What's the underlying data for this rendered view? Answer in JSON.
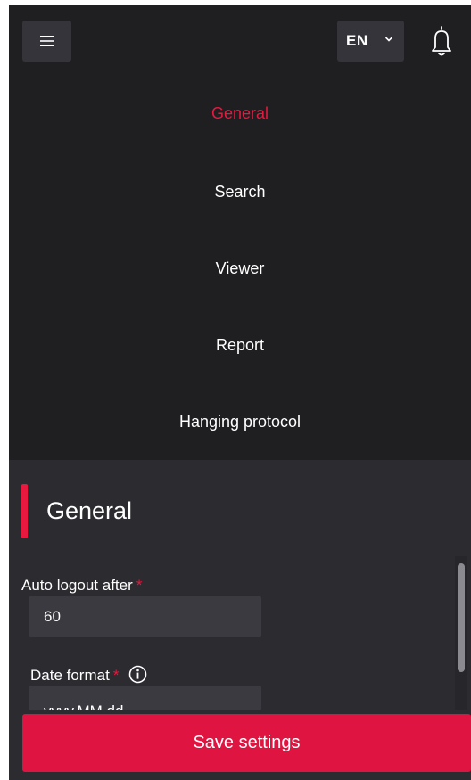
{
  "header": {
    "menu_icon": "hamburger-icon",
    "language": "EN",
    "language_icon": "chevron-down-icon",
    "notifications_icon": "bell-icon"
  },
  "nav": {
    "items": [
      {
        "label": "General",
        "active": true
      },
      {
        "label": "Search",
        "active": false
      },
      {
        "label": "Viewer",
        "active": false
      },
      {
        "label": "Report",
        "active": false
      },
      {
        "label": "Hanging protocol",
        "active": false
      }
    ]
  },
  "section": {
    "title": "General"
  },
  "fields": {
    "auto_logout": {
      "label": "Auto logout after",
      "required_mark": "*",
      "value": "60"
    },
    "date_format": {
      "label": "Date format",
      "required_mark": "*",
      "info_icon": "info-icon",
      "value": "yyyy.MM.dd"
    }
  },
  "actions": {
    "save_label": "Save settings"
  },
  "colors": {
    "accent": "#e8183f",
    "background": "#1f1f22",
    "panel": "#2b2b30",
    "input": "#3a3a40"
  }
}
